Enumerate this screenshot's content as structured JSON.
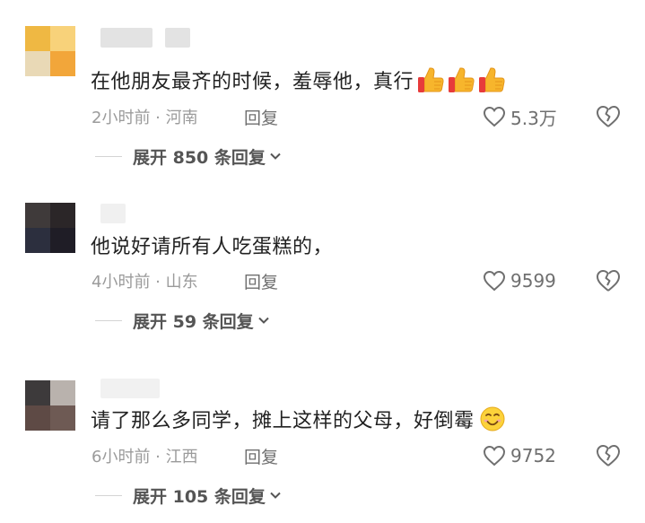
{
  "comments": [
    {
      "text": "在他朋友最齐的时候，羞辱他，真行",
      "emoji": [
        "thumbs-up-icon",
        "thumbs-up-icon",
        "thumbs-up-icon"
      ],
      "meta": "2小时前 · 河南",
      "reply_label": "回复",
      "likes": "5.3万",
      "expand": "展开 850 条回复",
      "avatar_colors": [
        "#efb843",
        "#f8d27a",
        "#e9d9b6",
        "#f2a63a"
      ]
    },
    {
      "text": "他说好请所有人吃蛋糕的，",
      "emoji": [],
      "meta": "4小时前 · 山东",
      "reply_label": "回复",
      "likes": "9599",
      "expand": "展开 59 条回复",
      "avatar_colors": [
        "#3f3a3a",
        "#2b2628",
        "#2c2f3e",
        "#1f1d26"
      ]
    },
    {
      "text": "请了那么多同学，摊上这样的父母，好倒霉",
      "emoji": [
        "smiling-face-icon"
      ],
      "meta": "6小时前 · 江西",
      "reply_label": "回复",
      "likes": "9752",
      "expand": "展开 105 条回复",
      "avatar_colors": [
        "#3d3a3b",
        "#b9b2ad",
        "#5e4a45",
        "#6e5a54"
      ]
    }
  ]
}
